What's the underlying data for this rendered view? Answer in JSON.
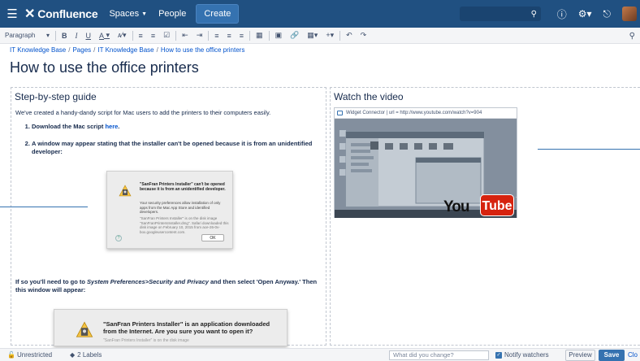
{
  "app": {
    "name": "Confluence"
  },
  "nav": {
    "spaces": "Spaces",
    "people": "People",
    "create": "Create"
  },
  "toolbar": {
    "paragraph": "Paragraph",
    "bold": "B",
    "italic": "I",
    "underline": "U",
    "text_color": "A"
  },
  "breadcrumb": {
    "items": [
      "IT Knowledge Base",
      "Pages",
      "IT Knowledge Base",
      "How to use the office printers"
    ],
    "separator": "/"
  },
  "page": {
    "title": "How to use the office printers"
  },
  "left_column": {
    "heading": "Step-by-step guide",
    "intro": "We've created a handy-dandy script for Mac users to add the printers to their computers easily.",
    "step1_prefix": "Download the Mac script ",
    "step1_link": "here",
    "step1_suffix": ".",
    "step2": "A window may appear stating that the installer can't be opened because it is from an unidentified developer:",
    "dialog1": {
      "title": "\"SanFran Printers Installer\" can't be opened because it is from an unidentified developer.",
      "body": "Your security preferences allow installation of only apps from the Mac App Store and identified developers.",
      "detail": "\"SanFran Printers Installer\" is on the disk image \"SanFranPrintersInstaller.dmg\". Safari downloaded this disk image on February 10, 2015 from ace-26-0v-box.googleusercontent.com.",
      "ok": "OK",
      "help": "?"
    },
    "para2_prefix": "If so you'll need to go to ",
    "para2_italic": "System Preferences>Security and Privacy",
    "para2_suffix": " and then select 'Open Anyway.' Then this window will appear:",
    "dialog2": {
      "title": "\"SanFran Printers Installer\" is an application downloaded from the Internet. Are you sure you want to open it?",
      "detail": "\"SanFran Printers Installer\" is on the disk image"
    }
  },
  "right_column": {
    "heading": "Watch the video",
    "widget_label": "Widget Connector | url = http://www.youtube.com/watch?v=904",
    "yt_you": "You",
    "yt_tube": "Tube",
    "yt_tm": "TM"
  },
  "bottom": {
    "restrictions": "Unrestricted",
    "labels": "2 Labels",
    "change_placeholder": "What did you change?",
    "notify": "Notify watchers",
    "preview": "Preview",
    "save": "Save",
    "close": "Clo"
  },
  "colors": {
    "header_bg": "#205081",
    "create_bg": "#3572b0",
    "link": "#0052cc",
    "save_bg": "#3572b0",
    "youtube_red": "#d6230f"
  }
}
